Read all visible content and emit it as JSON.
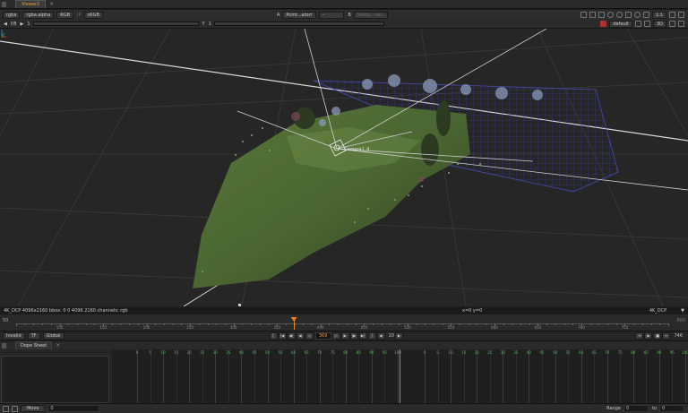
{
  "tabbar": {
    "viewer_tab": "Viewer2"
  },
  "toolbar1": {
    "channels": "rgba",
    "alpha_channel": "rgba.alpha",
    "colorspace_in": "RGB",
    "input_process_label": "IP",
    "colorspace_out": "sRGB",
    "input_a_label": "A",
    "input_a_value": "Point...atorr",
    "compare_value": "-",
    "input_b_label": "B",
    "input_b_value": "Shotp...nav",
    "zoom_value": "1:1"
  },
  "toolbar2": {
    "fstop_label": "f/8",
    "gain_value": "1",
    "y_label": "Y",
    "y_value": "1",
    "view_mode": "default",
    "view_3d": "3D"
  },
  "viewport": {
    "camera_label": "Camera1_4"
  },
  "infobar": {
    "format_info": "4K_DCP 4096x2160  bbox: 0 0 4096 2160 channels: rgb",
    "coords": "x=0 y=0",
    "format_right": "4K_DCP"
  },
  "frameslider": {
    "start": "50",
    "end": "800",
    "ticks": [
      "50",
      "100",
      "150",
      "200",
      "250",
      "300",
      "350",
      "400",
      "450",
      "500",
      "550",
      "600",
      "650",
      "700",
      "750",
      "800"
    ],
    "current_frame": 369
  },
  "playback": {
    "status": "Invalid",
    "tf_label": "TF",
    "scope": "Global",
    "current_frame": "369",
    "step": "10",
    "end_frame": "746"
  },
  "dopesheet": {
    "tab_label": "Dope Sheet",
    "ticks": [
      "0",
      "5",
      "10",
      "15",
      "20",
      "25",
      "30",
      "35",
      "40",
      "45",
      "50",
      "55",
      "60",
      "65",
      "70",
      "75",
      "80",
      "85",
      "90",
      "95",
      "100"
    ]
  },
  "statusbar": {
    "move_label": "Move",
    "move_value": "0",
    "range_label": "Range",
    "range_from": "0",
    "range_to_label": "to",
    "range_to": "0"
  },
  "colors": {
    "accent_orange": "#e6801a",
    "tab_active": "#e6a23c",
    "dope_label_green": "#5fb25f",
    "background": "#1e1e1e"
  }
}
